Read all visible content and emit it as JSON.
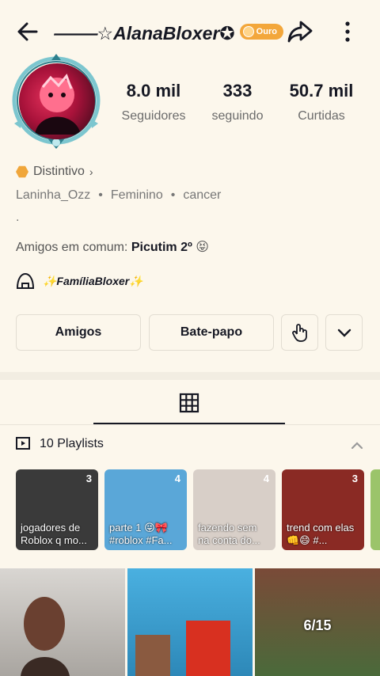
{
  "header": {
    "title": "⸻☆AlanaBloxer✪",
    "badge": "Ouro"
  },
  "stats": [
    {
      "value": "8.0 mil",
      "label": "Seguidores"
    },
    {
      "value": "333",
      "label": "seguindo"
    },
    {
      "value": "50.7 mil",
      "label": "Curtidas"
    }
  ],
  "profile": {
    "distintivo": "Distintivo",
    "username": "Laninha_Ozz",
    "gender": "Feminino",
    "sign": "cancer",
    "bio_dot": ".",
    "mutual_label": "Amigos em comum:",
    "mutual_name": "Picutim 2º",
    "mutual_emoji": "😝",
    "family": "✨FamíliaBloxer✨"
  },
  "actions": {
    "friends": "Amigos",
    "chat": "Bate-papo"
  },
  "playlists": {
    "header": "10 Playlists",
    "items": [
      {
        "count": "3",
        "caption": "jogadores de Roblox q mo...",
        "color": "#3a3a3a"
      },
      {
        "count": "4",
        "caption": "parte 1 😜🎀 #roblox #Fa...",
        "color": "#5aa7d8"
      },
      {
        "count": "4",
        "caption": "fazendo sem na conta do...",
        "color": "#d8cfc8"
      },
      {
        "count": "3",
        "caption": "trend com elas 👊😄 #...",
        "color": "#8a2a24"
      }
    ]
  },
  "videos": [
    {
      "label": "",
      "color": "#c9c6c2"
    },
    {
      "label": "",
      "color": "#3fa7d6"
    },
    {
      "label": "6/15",
      "color": "#5a4f3a"
    }
  ]
}
